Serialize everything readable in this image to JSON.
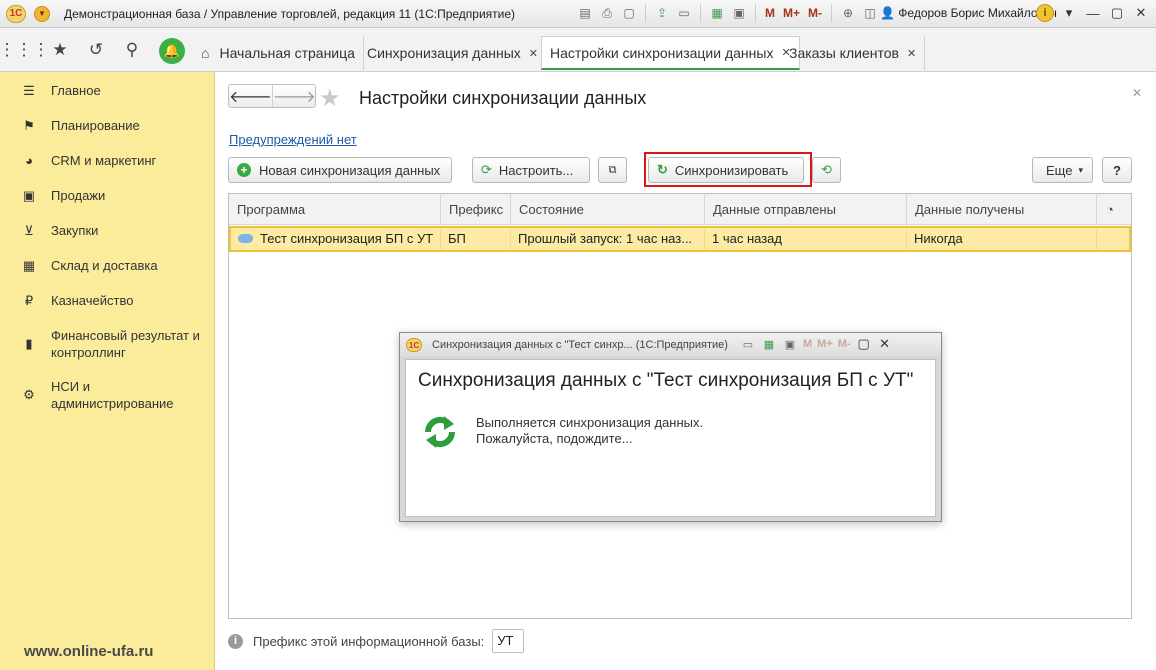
{
  "titlebar": {
    "title": "Демонстрационная база / Управление торговлей, редакция 11  (1С:Предприятие)",
    "logo_text": "1С",
    "memory_buttons": [
      "M",
      "M+",
      "M-"
    ],
    "user": "Федоров Борис Михайлович",
    "icons": [
      "save-icon",
      "print-icon",
      "preview-icon",
      "upload-icon",
      "printer-icon",
      "calculator-icon",
      "calendar-icon",
      "zoom-icon",
      "panel-icon",
      "info-icon",
      "minimize-icon",
      "maximize-icon",
      "close-icon"
    ]
  },
  "tabs": [
    {
      "label": "Начальная страница",
      "closable": false
    },
    {
      "label": "Синхронизация данных",
      "closable": true
    },
    {
      "label": "Настройки синхронизации данных",
      "closable": true,
      "active": true
    },
    {
      "label": "Заказы клиентов",
      "closable": true
    }
  ],
  "sidebar": {
    "items": [
      {
        "label": "Главное",
        "icon": "menu-icon"
      },
      {
        "label": "Планирование",
        "icon": "planning-icon"
      },
      {
        "label": "CRM и маркетинг",
        "icon": "crm-icon"
      },
      {
        "label": "Продажи",
        "icon": "sales-icon"
      },
      {
        "label": "Закупки",
        "icon": "cart-icon"
      },
      {
        "label": "Склад и доставка",
        "icon": "warehouse-icon"
      },
      {
        "label": "Казначейство",
        "icon": "ruble-icon"
      },
      {
        "label": "Финансовый результат и контроллинг",
        "icon": "chart-icon"
      },
      {
        "label": "НСИ и администрирование",
        "icon": "gear-icon"
      }
    ],
    "watermark": "www.online-ufa.ru"
  },
  "page": {
    "title": "Настройки синхронизации данных",
    "warnings_link": "Предупреждений нет",
    "buttons": {
      "new_sync": "Новая синхронизация данных",
      "configure": "Настроить...",
      "synchronize": "Синхронизировать",
      "more": "Еще",
      "help": "?"
    }
  },
  "table": {
    "headers": [
      "Программа",
      "Префикс",
      "Состояние",
      "Данные отправлены",
      "Данные получены"
    ],
    "rows": [
      {
        "program": "Тест синхронизация БП с УТ",
        "prefix": "БП",
        "status": "Прошлый запуск: 1 час наз...",
        "sent": "1 час назад",
        "received": "Никогда"
      }
    ]
  },
  "footer": {
    "label": "Префикс этой информационной базы:",
    "value": "УТ"
  },
  "modal": {
    "window_title": "Синхронизация данных с \"Тест синхр...  (1С:Предприятие)",
    "heading": "Синхронизация данных с \"Тест синхронизация БП с УТ\"",
    "line1": "Выполняется синхронизация данных.",
    "line2": "Пожалуйста, подождите...",
    "memory_buttons": [
      "M",
      "M+",
      "M-"
    ]
  },
  "colors": {
    "sidebar_bg": "#fbec9c",
    "selected_row": "#fdeaa4",
    "selected_row_border": "#f1c232",
    "accent_green": "#3aa845",
    "highlight_red": "#d7191c",
    "link_blue": "#1f5aa8"
  }
}
